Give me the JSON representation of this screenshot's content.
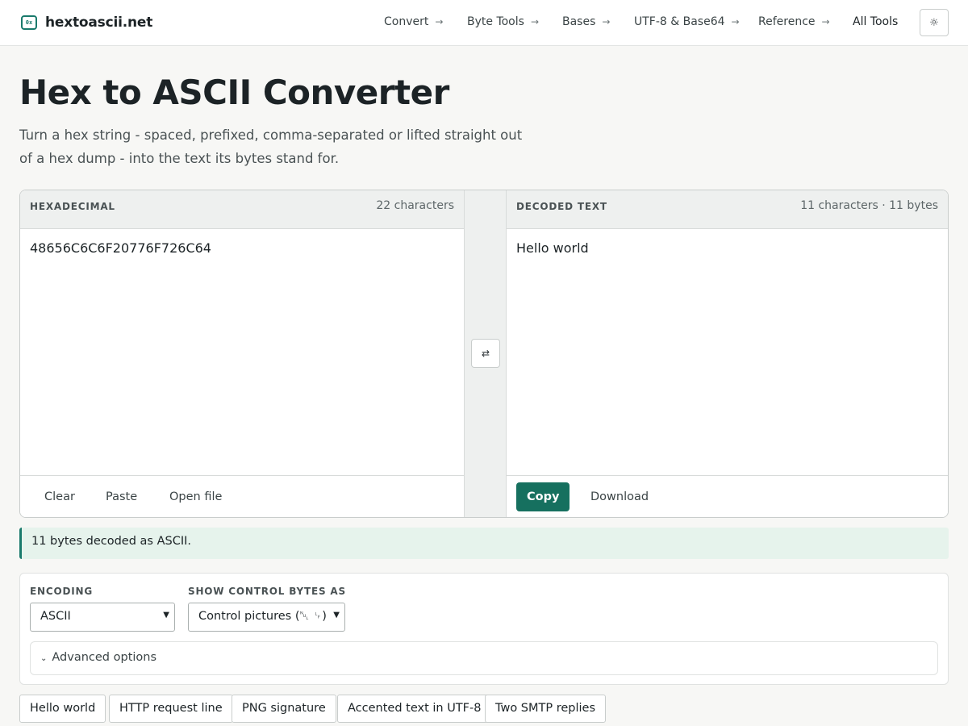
{
  "header": {
    "logo_mark": "0x",
    "site_name": "hextoascii.net",
    "nav": [
      {
        "label": "Convert",
        "arrow": "→"
      },
      {
        "label": "Byte Tools",
        "arrow": "→"
      },
      {
        "label": "Bases",
        "arrow": "→"
      },
      {
        "label": "UTF-8 & Base64",
        "arrow": "→"
      },
      {
        "label": "Reference",
        "arrow": "→"
      },
      {
        "label": "All Tools"
      }
    ],
    "theme_icon": "sun-icon",
    "theme_glyph": "☼"
  },
  "page": {
    "title": "Hex to ASCII Converter",
    "subtitle": "Turn a hex string - spaced, prefixed, comma-separated or lifted straight out of a hex dump - into the text its bytes stand for."
  },
  "converter": {
    "input": {
      "label": "HEXADECIMAL",
      "count": "22 characters",
      "value": "48656C6C6F20776F726C64",
      "actions": [
        "Clear",
        "Paste",
        "Open file"
      ]
    },
    "swap_glyph": "⇄",
    "output": {
      "label": "DECODED TEXT",
      "count": "11 characters · 11 bytes",
      "value": "Hello world",
      "copy_label": "Copy",
      "download_label": "Download"
    }
  },
  "status": {
    "message": "11 bytes decoded as ASCII."
  },
  "options": {
    "encoding_label": "ENCODING",
    "encoding_value": "ASCII",
    "control_label": "SHOW CONTROL BYTES AS",
    "control_value": "Control pictures (␀ ␊)",
    "advanced_label": "Advanced options"
  },
  "samples": [
    "Hello world",
    "HTTP request line",
    "PNG signature",
    "Accented text in UTF-8",
    "Two SMTP replies"
  ],
  "colors": {
    "accent": "#16705f",
    "status_bg": "#e6f3ec"
  }
}
